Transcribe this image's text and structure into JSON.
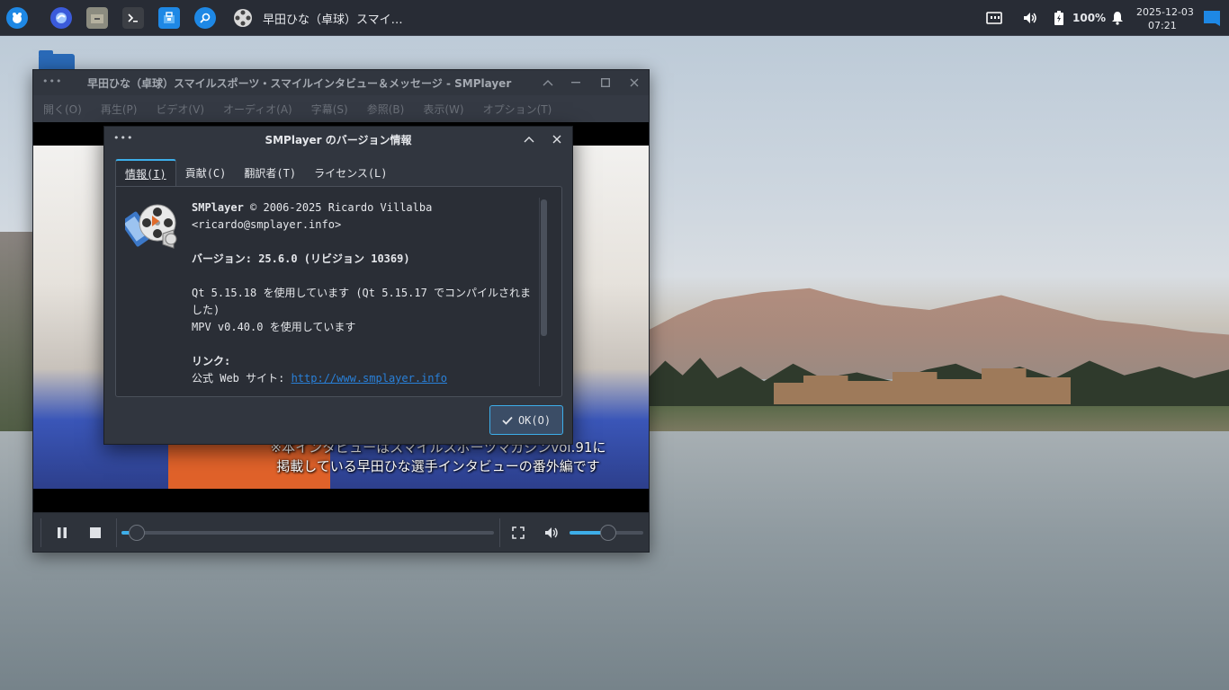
{
  "taskbar": {
    "active_title": "早田ひな（卓球）スマイ…",
    "battery": "100%",
    "date": "2025-12-03",
    "time": "07:21",
    "icons": [
      "app-launcher-icon",
      "browser-icon",
      "file-manager-icon",
      "terminal-icon",
      "software-store-icon",
      "search-icon",
      "smplayer-icon",
      "network-icon",
      "volume-icon",
      "battery-icon",
      "bell-icon",
      "desktop-icon"
    ]
  },
  "main_window": {
    "title": "早田ひな（卓球）スマイルスポーツ・スマイルインタビュー＆メッセージ - SMPlayer",
    "menu": [
      "開く(O)",
      "再生(P)",
      "ビデオ(V)",
      "オーディオ(A)",
      "字幕(S)",
      "参照(B)",
      "表示(W)",
      "オプション(T)"
    ],
    "subtitle_line1": "※本インタビューはスマイルスポーツマガジンvol.91に",
    "subtitle_line2": "掲載している早田ひな選手インタビューの番外編です",
    "seek_position": 0.04,
    "volume_level": 0.52
  },
  "about_dialog": {
    "title": "SMPlayer のバージョン情報",
    "tabs": [
      "情報(I)",
      "貢献(C)",
      "翻訳者(T)",
      "ライセンス(L)"
    ],
    "app_name": "SMPlayer",
    "copyright": " © 2006-2025 Ricardo Villalba",
    "email": "<ricardo@smplayer.info>",
    "version_line": "バージョン: 25.6.0 (リビジョン 10369)",
    "qt_line1": "Qt 5.15.18 を使用しています (Qt 5.15.17 でコンパイルされま",
    "qt_line2": "した)",
    "mpv_line": "MPV v0.40.0 を使用しています",
    "links_heading": "リンク:",
    "website_label": "公式 Web サイト: ",
    "website_url": "http://www.smplayer.info",
    "ok_label": "OK(O)"
  },
  "colors": {
    "accent": "#3daee9",
    "panel_bg": "#282c35",
    "window_bg": "#31363f"
  }
}
